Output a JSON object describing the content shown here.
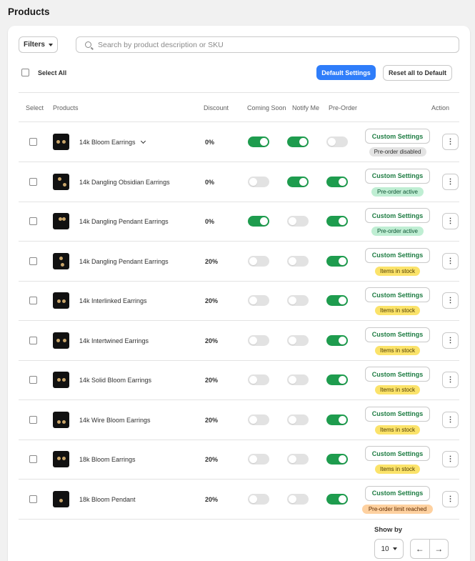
{
  "page": {
    "title": "Products"
  },
  "toolbar": {
    "filters_label": "Filters",
    "search_placeholder": "Search by product description or SKU",
    "select_all_label": "Select All",
    "default_settings_label": "Default Settings",
    "reset_label": "Reset all to Default"
  },
  "columns": [
    "Select",
    "Products",
    "Discount",
    "Coming Soon",
    "Notify Me",
    "Pre-Order",
    "Action"
  ],
  "rows": [
    {
      "name": "14k Bloom Earrings",
      "expandable": true,
      "discount": "0%",
      "coming_soon": true,
      "notify_me": true,
      "pre_order": false,
      "action": "Custom Settings",
      "status": "Pre-order disabled",
      "status_tone": "gray"
    },
    {
      "name": "14k Dangling Obsidian Earrings",
      "expandable": false,
      "discount": "0%",
      "coming_soon": false,
      "notify_me": true,
      "pre_order": true,
      "action": "Custom Settings",
      "status": "Pre-order active",
      "status_tone": "green"
    },
    {
      "name": "14k Dangling Pendant Earrings",
      "expandable": false,
      "discount": "0%",
      "coming_soon": true,
      "notify_me": false,
      "pre_order": true,
      "action": "Custom Settings",
      "status": "Pre-order active",
      "status_tone": "green"
    },
    {
      "name": "14k Dangling Pendant Earrings",
      "expandable": false,
      "discount": "20%",
      "coming_soon": false,
      "notify_me": false,
      "pre_order": true,
      "action": "Custom Settings",
      "status": "Items in stock",
      "status_tone": "yellow"
    },
    {
      "name": "14k Interlinked Earrings",
      "expandable": false,
      "discount": "20%",
      "coming_soon": false,
      "notify_me": false,
      "pre_order": true,
      "action": "Custom Settings",
      "status": "Items in stock",
      "status_tone": "yellow"
    },
    {
      "name": "14k Intertwined Earrings",
      "expandable": false,
      "discount": "20%",
      "coming_soon": false,
      "notify_me": false,
      "pre_order": true,
      "action": "Custom Settings",
      "status": "Items in stock",
      "status_tone": "yellow"
    },
    {
      "name": "14k Solid Bloom Earrings",
      "expandable": false,
      "discount": "20%",
      "coming_soon": false,
      "notify_me": false,
      "pre_order": true,
      "action": "Custom Settings",
      "status": "Items in stock",
      "status_tone": "yellow"
    },
    {
      "name": "14k Wire Bloom Earrings",
      "expandable": false,
      "discount": "20%",
      "coming_soon": false,
      "notify_me": false,
      "pre_order": true,
      "action": "Custom Settings",
      "status": "Items in stock",
      "status_tone": "yellow"
    },
    {
      "name": "18k Bloom Earrings",
      "expandable": false,
      "discount": "20%",
      "coming_soon": false,
      "notify_me": false,
      "pre_order": true,
      "action": "Custom Settings",
      "status": "Items in stock",
      "status_tone": "yellow"
    },
    {
      "name": "18k Bloom Pendant",
      "expandable": false,
      "discount": "20%",
      "coming_soon": false,
      "notify_me": false,
      "pre_order": true,
      "action": "Custom Settings",
      "status": "Pre-order limit reached",
      "status_tone": "orange"
    }
  ],
  "pagination": {
    "show_by_label": "Show by",
    "per_page": "10",
    "prev_icon": "arrow-left-icon",
    "next_icon": "arrow-right-icon"
  },
  "colors": {
    "accent": "#2f7dfa",
    "toggle_on": "#1e9c4e",
    "action_text": "#1d7c42"
  }
}
